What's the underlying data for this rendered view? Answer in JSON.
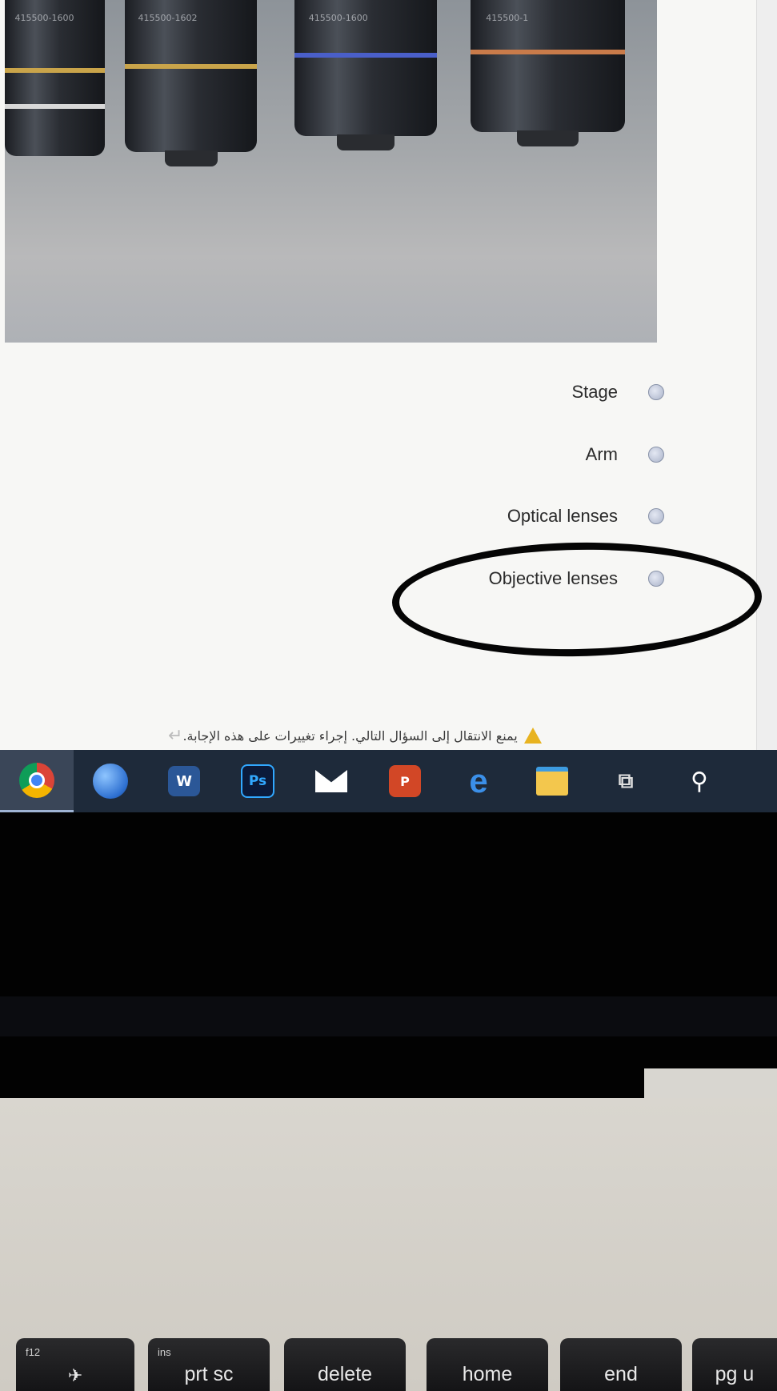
{
  "quiz": {
    "options": [
      {
        "label": "Stage"
      },
      {
        "label": "Arm"
      },
      {
        "label": "Optical lenses"
      },
      {
        "label": "Objective lenses"
      }
    ],
    "warning_text": "يمنع الانتقال إلى السؤال التالي. إجراء تغييرات على هذه الإجابة."
  },
  "photo": {
    "lens_engravings": [
      "415500-1600",
      "415500-1602",
      "415500-1600",
      "415500-1"
    ]
  },
  "taskbar": {
    "apps": [
      {
        "name": "chrome-icon",
        "active": true
      },
      {
        "name": "google-earth-icon"
      },
      {
        "name": "word-icon",
        "glyph": "W"
      },
      {
        "name": "photoshop-icon",
        "glyph": "Ps"
      },
      {
        "name": "mail-icon"
      },
      {
        "name": "powerpoint-icon",
        "glyph": "P"
      },
      {
        "name": "edge-icon",
        "glyph": "e"
      },
      {
        "name": "file-explorer-icon"
      },
      {
        "name": "task-view-icon",
        "glyph": "⧉"
      },
      {
        "name": "search-icon",
        "glyph": "⚲"
      }
    ]
  },
  "keyboard": {
    "keys": [
      {
        "label": "",
        "sub": "f12",
        "icon": "✈"
      },
      {
        "label": "prt sc",
        "sub": "ins"
      },
      {
        "label": "delete",
        "sub": ""
      },
      {
        "label": "home",
        "sub": ""
      },
      {
        "label": "end",
        "sub": ""
      },
      {
        "label": "pg u",
        "sub": ""
      }
    ]
  },
  "colors": {
    "taskbar_bg": "#1e2a3a",
    "warning_icon": "#e8b320",
    "radio": "#aab3c9"
  }
}
